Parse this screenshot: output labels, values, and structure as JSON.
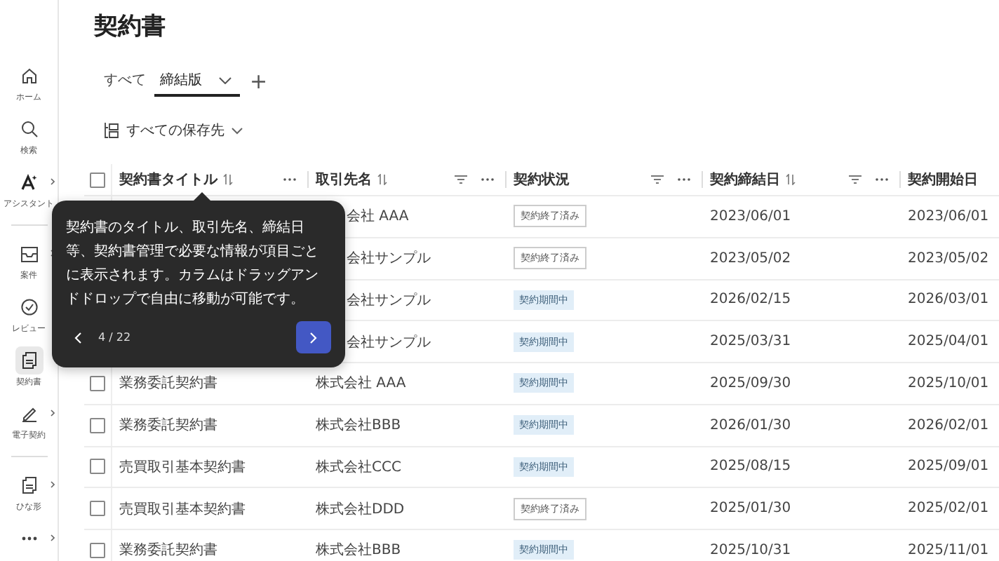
{
  "sidebar": {
    "sections": [
      [
        {
          "kind": "home",
          "label": "ホーム",
          "selected": false,
          "submenu": false
        },
        {
          "kind": "search",
          "label": "検索",
          "selected": false,
          "submenu": false
        },
        {
          "kind": "assistant",
          "label": "アシスタント",
          "selected": false,
          "submenu": true
        }
      ],
      [
        {
          "kind": "inbox",
          "label": "案件",
          "selected": false,
          "submenu": true
        },
        {
          "kind": "review",
          "label": "レビュー",
          "selected": false,
          "submenu": false
        },
        {
          "kind": "document",
          "label": "契約書",
          "selected": true,
          "submenu": false
        },
        {
          "kind": "pen",
          "label": "電子契約",
          "selected": false,
          "submenu": true
        }
      ],
      [
        {
          "kind": "template",
          "label": "ひな形",
          "selected": false,
          "submenu": true
        },
        {
          "kind": "more",
          "selected": false,
          "submenu": true
        }
      ]
    ]
  },
  "page_title": "契約書",
  "tabs": [
    {
      "label": "すべて",
      "selected": false,
      "dropdown": false
    },
    {
      "label": "締結版",
      "selected": true,
      "dropdown": true
    }
  ],
  "add_tab": "+",
  "storage_filter": "すべての保存先",
  "table": {
    "select_all_checked": false,
    "columns": [
      {
        "label": "契約書タイトル",
        "sortable": true,
        "filter": false,
        "menu": true
      },
      {
        "label": "取引先名",
        "sortable": true,
        "filter": true,
        "menu": true
      },
      {
        "label": "契約状況",
        "sortable": false,
        "filter": true,
        "menu": true
      },
      {
        "label": "契約締結日",
        "sortable": true,
        "filter": true,
        "menu": true
      },
      {
        "label": "契約開始日"
      }
    ],
    "rows": [
      {
        "client": "会社 AAA",
        "status": {
          "kind": "ended",
          "label": "契約終了済み"
        },
        "signed": "2023/06/01",
        "start": "2023/06/01"
      },
      {
        "client": "会社サンプル",
        "status": {
          "kind": "ended",
          "label": "契約終了済み"
        },
        "signed": "2023/05/02",
        "start": "2023/05/02"
      },
      {
        "client": "会社サンプル",
        "status": {
          "kind": "active",
          "label": "契約期間中"
        },
        "signed": "2026/02/15",
        "start": "2026/03/01"
      },
      {
        "client": "会社サンプル",
        "status": {
          "kind": "active",
          "label": "契約期間中"
        },
        "signed": "2025/03/31",
        "start": "2025/04/01"
      },
      {
        "title": "業務委託契約書",
        "checked": false,
        "client": "株式会社 AAA",
        "status": {
          "kind": "active",
          "label": "契約期間中"
        },
        "signed": "2025/09/30",
        "start": "2025/10/01"
      },
      {
        "title": "業務委託契約書",
        "checked": false,
        "client": "株式会社BBB",
        "status": {
          "kind": "active",
          "label": "契約期間中"
        },
        "signed": "2026/01/30",
        "start": "2026/02/01"
      },
      {
        "title": "売買取引基本契約書",
        "checked": false,
        "client": "株式会社CCC",
        "status": {
          "kind": "active",
          "label": "契約期間中"
        },
        "signed": "2025/08/15",
        "start": "2025/09/01"
      },
      {
        "title": "売買取引基本契約書",
        "checked": false,
        "client": "株式会社DDD",
        "status": {
          "kind": "ended",
          "label": "契約終了済み"
        },
        "signed": "2025/01/30",
        "start": "2025/02/01"
      },
      {
        "title": "業務委託契約書",
        "checked": false,
        "client": "株式会社BBB",
        "status": {
          "kind": "active",
          "label": "契約期間中"
        },
        "signed": "2025/10/31",
        "start": "2025/11/01"
      }
    ]
  },
  "tour_tip": {
    "text": "契約書のタイトル、取引先名、締結日等、契約書管理で必要な情報が項目ごとに表示されます。カラムはドラッグアンドドロップで自由に移動が可能です。",
    "step": "4 / 22"
  }
}
